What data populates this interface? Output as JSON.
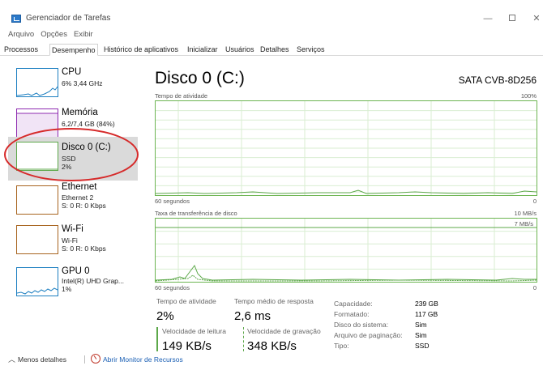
{
  "window": {
    "title": "Gerenciador de Tarefas",
    "minimize": "—",
    "close": "✕"
  },
  "menu": [
    "Arquivo",
    "Opções",
    "Exibir"
  ],
  "tabs": [
    "Processos",
    "Desempenho",
    "Histórico de aplicativos",
    "Inicializar",
    "Usuários",
    "Detalhes",
    "Serviços"
  ],
  "sidebar": {
    "items": [
      {
        "name": "CPU",
        "lines": [
          "6% 3,44 GHz"
        ],
        "color": "#1d7fc1"
      },
      {
        "name": "Memória",
        "lines": [
          "6,2/7,4 GB (84%)"
        ],
        "color": "#8e2bb0"
      },
      {
        "name": "Disco 0 (C:)",
        "lines": [
          "SSD",
          "2%"
        ],
        "color": "#5da84a"
      },
      {
        "name": "Ethernet",
        "lines": [
          "Ethernet 2",
          "S: 0 R: 0 Kbps"
        ],
        "color": "#a8641f"
      },
      {
        "name": "Wi-Fi",
        "lines": [
          "Wi-Fi",
          "S: 0 R: 0 Kbps"
        ],
        "color": "#a8641f"
      },
      {
        "name": "GPU 0",
        "lines": [
          "Intel(R) UHD Grap...",
          "1%"
        ],
        "color": "#1d7fc1"
      }
    ]
  },
  "panel": {
    "title": "Disco 0 (C:)",
    "device": "SATA CVB-8D256",
    "graph1": {
      "label": "Tempo de atividade",
      "max": "100%",
      "xlabel": "60 segundos",
      "min": "0"
    },
    "graph2": {
      "label": "Taxa de transferência de disco",
      "max": "10 MB/s",
      "inner_max": "7 MB/s",
      "xlabel": "60 segundos",
      "min": "0"
    }
  },
  "stats": {
    "active_time_label": "Tempo de atividade",
    "active_time_value": "2%",
    "avg_response_label": "Tempo médio de resposta",
    "avg_response_value": "2,6 ms",
    "read_label": "Velocidade de leitura",
    "read_value": "149 KB/s",
    "write_label": "Velocidade de gravação",
    "write_value": "348 KB/s"
  },
  "info": [
    {
      "key": "Capacidade:",
      "value": "239 GB"
    },
    {
      "key": "Formatado:",
      "value": "117 GB"
    },
    {
      "key": "Disco do sistema:",
      "value": "Sim"
    },
    {
      "key": "Arquivo de paginação:",
      "value": "Sim"
    },
    {
      "key": "Tipo:",
      "value": "SSD"
    }
  ],
  "bottom": {
    "less_details": "Menos detalhes",
    "resource_monitor": "Abrir Monitor de Recursos"
  }
}
